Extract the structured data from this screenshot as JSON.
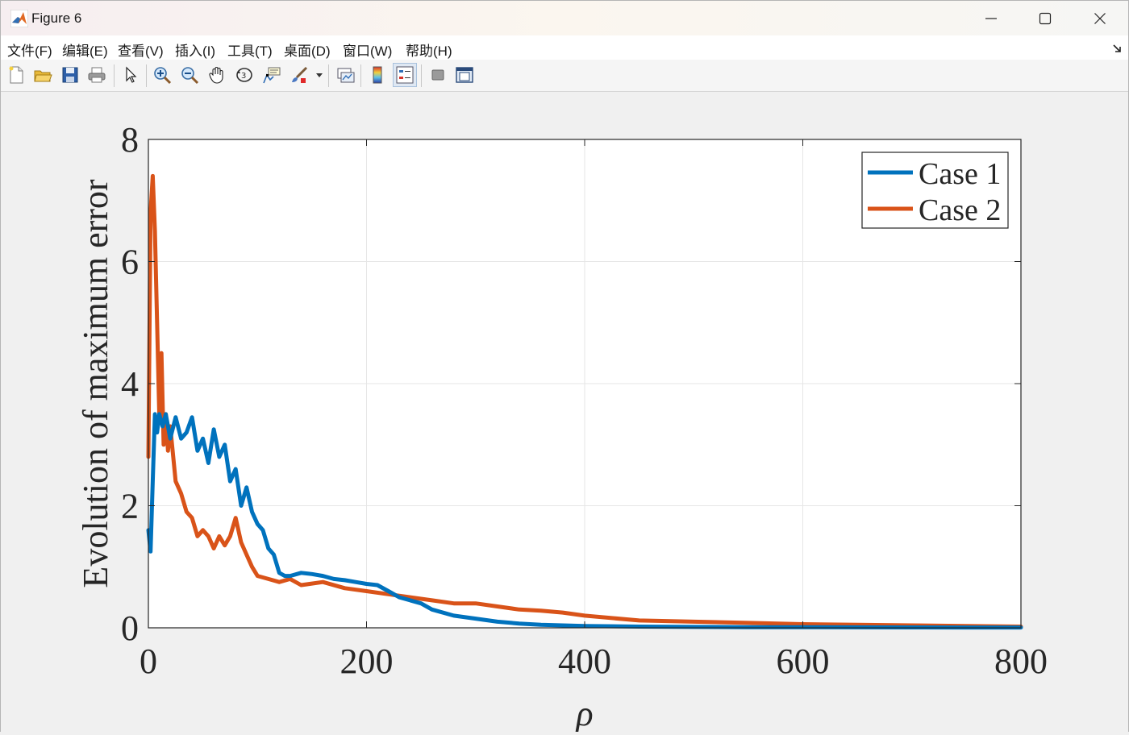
{
  "window": {
    "title": "Figure 6",
    "icons": [
      "matlab-logo-icon",
      "minimize-icon",
      "maximize-icon",
      "close-icon"
    ]
  },
  "menu": {
    "items": [
      "文件(F)",
      "编辑(E)",
      "查看(V)",
      "插入(I)",
      "工具(T)",
      "桌面(D)",
      "窗口(W)",
      "帮助(H)"
    ]
  },
  "toolbar": {
    "icons": [
      "new-figure-icon",
      "open-file-icon",
      "save-icon",
      "print-icon",
      "edit-plot-arrow-icon",
      "zoom-in-icon",
      "zoom-out-icon",
      "pan-hand-icon",
      "rotate-3d-icon",
      "data-cursor-icon",
      "brush-icon",
      "brush-dropdown-icon",
      "link-plot-icon",
      "colorbar-icon",
      "legend-icon",
      "hide-plot-tools-icon",
      "show-plot-tools-icon"
    ]
  },
  "colors": {
    "case1": "#0072bd",
    "case2": "#d95319",
    "grid": "#e6e6e6",
    "axes": "#262626"
  },
  "chart_data": {
    "type": "line",
    "xlabel": "ρ",
    "ylabel": "Evolution of maximum error",
    "xlim": [
      0,
      800
    ],
    "ylim": [
      0,
      8
    ],
    "xticks": [
      "0",
      "200",
      "400",
      "600",
      "800"
    ],
    "yticks": [
      "0",
      "2",
      "4",
      "6",
      "8"
    ],
    "grid": true,
    "legend_position": "top-right",
    "series": [
      {
        "name": "Case 1",
        "color": "#0072bd",
        "x": [
          0,
          2,
          4,
          6,
          8,
          10,
          13,
          16,
          20,
          25,
          30,
          35,
          40,
          45,
          50,
          55,
          60,
          65,
          70,
          75,
          80,
          85,
          90,
          95,
          100,
          105,
          110,
          115,
          120,
          125,
          130,
          140,
          150,
          160,
          170,
          180,
          190,
          200,
          210,
          220,
          230,
          240,
          250,
          260,
          280,
          300,
          320,
          340,
          360,
          380,
          400,
          450,
          500,
          550,
          600,
          650,
          700,
          750,
          800
        ],
        "y": [
          1.6,
          1.25,
          2.4,
          3.5,
          3.2,
          3.5,
          3.3,
          3.5,
          3.1,
          3.45,
          3.1,
          3.2,
          3.45,
          2.9,
          3.1,
          2.7,
          3.25,
          2.8,
          3.0,
          2.4,
          2.6,
          2.0,
          2.3,
          1.9,
          1.7,
          1.6,
          1.3,
          1.2,
          0.9,
          0.85,
          0.85,
          0.9,
          0.88,
          0.85,
          0.8,
          0.78,
          0.75,
          0.72,
          0.7,
          0.6,
          0.5,
          0.45,
          0.4,
          0.3,
          0.2,
          0.15,
          0.1,
          0.07,
          0.05,
          0.04,
          0.03,
          0.02,
          0.015,
          0.01,
          0.01,
          0.008,
          0.007,
          0.005,
          0.005
        ]
      },
      {
        "name": "Case 2",
        "color": "#d95319",
        "x": [
          0,
          2,
          4,
          6,
          8,
          10,
          12,
          14,
          16,
          18,
          20,
          25,
          30,
          35,
          40,
          45,
          50,
          55,
          60,
          65,
          70,
          75,
          80,
          85,
          90,
          95,
          100,
          110,
          120,
          130,
          140,
          160,
          180,
          200,
          220,
          240,
          260,
          280,
          300,
          320,
          340,
          360,
          380,
          400,
          450,
          500,
          550,
          600,
          650,
          700,
          750,
          800
        ],
        "y": [
          2.8,
          6.8,
          7.4,
          6.5,
          5.0,
          3.5,
          4.5,
          3.0,
          3.5,
          2.9,
          3.3,
          2.4,
          2.2,
          1.9,
          1.8,
          1.5,
          1.6,
          1.5,
          1.3,
          1.5,
          1.35,
          1.5,
          1.8,
          1.4,
          1.2,
          1.0,
          0.85,
          0.8,
          0.75,
          0.8,
          0.7,
          0.75,
          0.65,
          0.6,
          0.55,
          0.5,
          0.45,
          0.4,
          0.4,
          0.35,
          0.3,
          0.28,
          0.25,
          0.2,
          0.12,
          0.1,
          0.08,
          0.06,
          0.05,
          0.04,
          0.03,
          0.02
        ]
      }
    ]
  }
}
